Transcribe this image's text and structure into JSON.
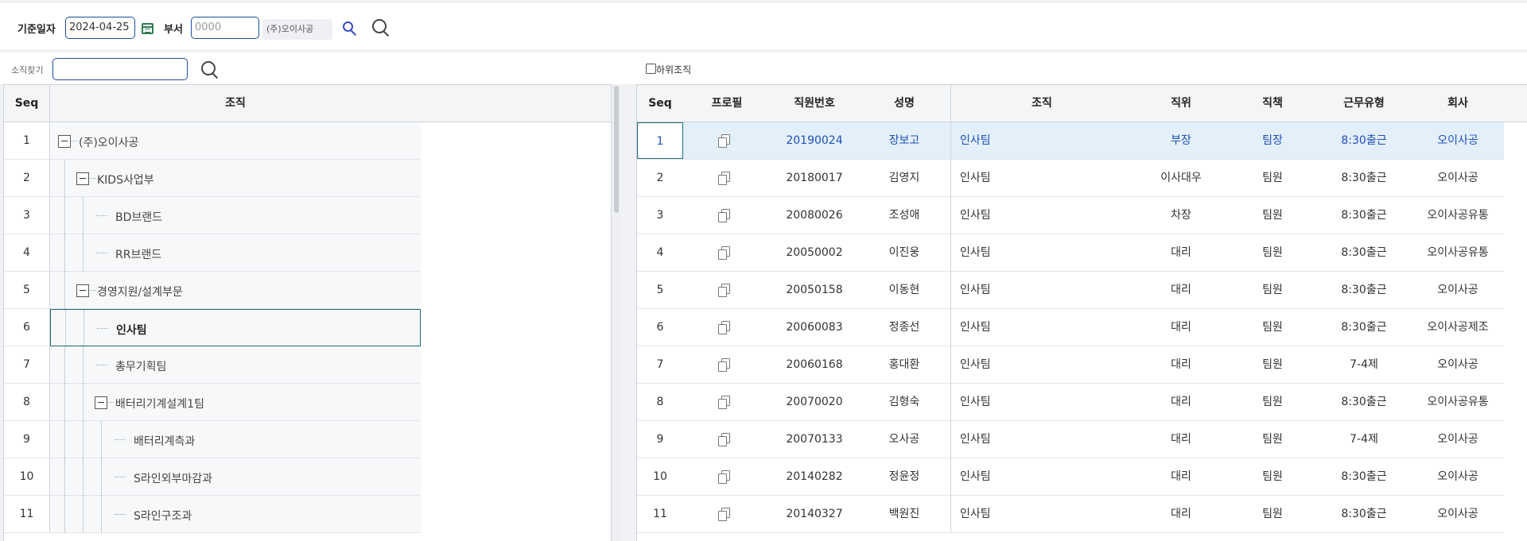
{
  "filter": {
    "date_label": "기준일자",
    "date_value": "2024-04-25",
    "dept_label": "부서",
    "dept_placeholder": "0000",
    "company_tag": "(주)오이사공"
  },
  "left": {
    "search_label": "소직찾기",
    "search_value": "",
    "headers": {
      "seq": "Seq",
      "org": "조직"
    },
    "rows": [
      {
        "seq": "1",
        "label": "(주)오이사공",
        "level": 0,
        "expandable": true
      },
      {
        "seq": "2",
        "label": "KIDS사업부",
        "level": 1,
        "expandable": true
      },
      {
        "seq": "3",
        "label": "BD브랜드",
        "level": 2,
        "expandable": false
      },
      {
        "seq": "4",
        "label": "RR브랜드",
        "level": 2,
        "expandable": false
      },
      {
        "seq": "5",
        "label": "경영지원/설계부문",
        "level": 1,
        "expandable": true
      },
      {
        "seq": "6",
        "label": "인사팀",
        "level": 2,
        "expandable": false,
        "selected": true
      },
      {
        "seq": "7",
        "label": "총무기획팀",
        "level": 2,
        "expandable": false
      },
      {
        "seq": "8",
        "label": "배터리기계설계1팀",
        "level": 2,
        "expandable": true
      },
      {
        "seq": "9",
        "label": "배터리계측과",
        "level": 3,
        "expandable": false
      },
      {
        "seq": "10",
        "label": "S라인외부마감과",
        "level": 3,
        "expandable": false
      },
      {
        "seq": "11",
        "label": "S라인구조과",
        "level": 3,
        "expandable": false
      }
    ]
  },
  "right": {
    "include_sub_label": "하위조직",
    "headers": {
      "seq": "Seq",
      "profile": "프로필",
      "emp_no": "직원번호",
      "name": "성명",
      "org": "조직",
      "position": "직위",
      "duty": "직책",
      "work_type": "근무유형",
      "company": "회사"
    },
    "rows": [
      {
        "seq": "1",
        "emp_no": "20190024",
        "name": "장보고",
        "org": "인사팀",
        "position": "부장",
        "duty": "팀장",
        "work_type": "8:30출근",
        "company": "오이사공",
        "selected": true
      },
      {
        "seq": "2",
        "emp_no": "20180017",
        "name": "김영지",
        "org": "인사팀",
        "position": "이사대우",
        "duty": "팀원",
        "work_type": "8:30출근",
        "company": "오이사공"
      },
      {
        "seq": "3",
        "emp_no": "20080026",
        "name": "조성애",
        "org": "인사팀",
        "position": "차장",
        "duty": "팀원",
        "work_type": "8:30출근",
        "company": "오이사공유통"
      },
      {
        "seq": "4",
        "emp_no": "20050002",
        "name": "이진웅",
        "org": "인사팀",
        "position": "대리",
        "duty": "팀원",
        "work_type": "8:30출근",
        "company": "오이사공유통"
      },
      {
        "seq": "5",
        "emp_no": "20050158",
        "name": "이동현",
        "org": "인사팀",
        "position": "대리",
        "duty": "팀원",
        "work_type": "8:30출근",
        "company": "오이사공"
      },
      {
        "seq": "6",
        "emp_no": "20060083",
        "name": "정종선",
        "org": "인사팀",
        "position": "대리",
        "duty": "팀원",
        "work_type": "8:30출근",
        "company": "오이사공제조"
      },
      {
        "seq": "7",
        "emp_no": "20060168",
        "name": "홍대환",
        "org": "인사팀",
        "position": "대리",
        "duty": "팀원",
        "work_type": "7-4제",
        "company": "오이사공"
      },
      {
        "seq": "8",
        "emp_no": "20070020",
        "name": "김형숙",
        "org": "인사팀",
        "position": "대리",
        "duty": "팀원",
        "work_type": "8:30출근",
        "company": "오이사공유통"
      },
      {
        "seq": "9",
        "emp_no": "20070133",
        "name": "오사공",
        "org": "인사팀",
        "position": "대리",
        "duty": "팀원",
        "work_type": "7-4제",
        "company": "오이사공"
      },
      {
        "seq": "10",
        "emp_no": "20140282",
        "name": "정윤정",
        "org": "인사팀",
        "position": "대리",
        "duty": "팀원",
        "work_type": "8:30출근",
        "company": "오이사공"
      },
      {
        "seq": "11",
        "emp_no": "20140327",
        "name": "백원진",
        "org": "인사팀",
        "position": "대리",
        "duty": "팀원",
        "work_type": "8:30출근",
        "company": "오이사공"
      }
    ]
  },
  "icons": {
    "calendar": "calendar-icon",
    "dept_search": "search-icon",
    "search": "search-icon",
    "tree_collapse": "minus-box-icon",
    "profile": "copy-icon"
  },
  "colors": {
    "input_border": "#1f4e9c",
    "selected_row_bg": "#e3f0fa",
    "selected_text": "#1f4fb8",
    "calendar": "#2e7d52",
    "small_search": "#3b4fc4"
  }
}
